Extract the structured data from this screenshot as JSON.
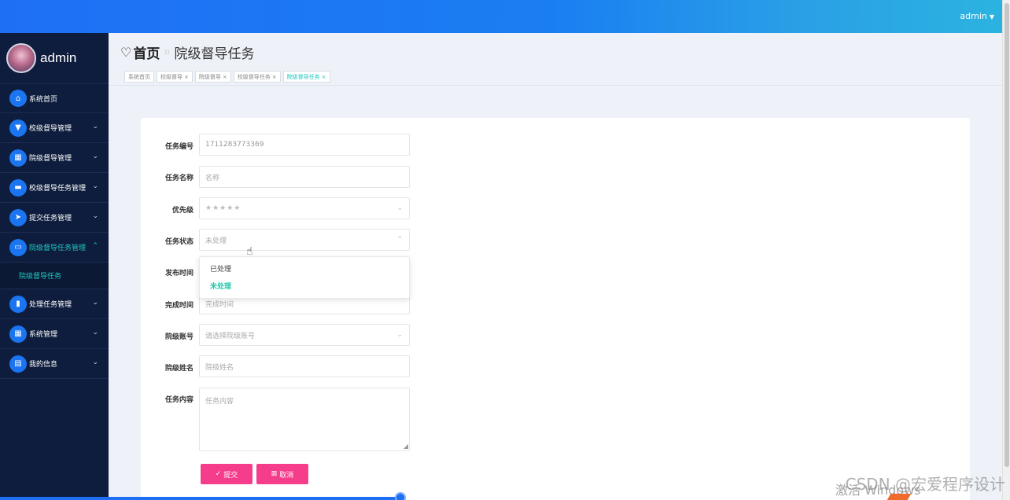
{
  "header": {
    "user": "admin"
  },
  "brand": {
    "name": "admin"
  },
  "sidebar": {
    "items": [
      {
        "label": "系统首页",
        "icon": "home-icon",
        "expanded": null
      },
      {
        "label": "校级督导管理",
        "icon": "presentation-icon",
        "expanded": false
      },
      {
        "label": "院级督导管理",
        "icon": "grid-icon",
        "expanded": false
      },
      {
        "label": "校级督导任务管理",
        "icon": "clipboard-icon",
        "expanded": false
      },
      {
        "label": "提交任务管理",
        "icon": "send-icon",
        "expanded": false
      },
      {
        "label": "院级督导任务管理",
        "icon": "monitor-icon",
        "expanded": true
      },
      {
        "label": "处理任务管理",
        "icon": "bar-chart-icon",
        "expanded": false
      },
      {
        "label": "系统管理",
        "icon": "grid-icon",
        "expanded": false
      },
      {
        "label": "我的信息",
        "icon": "card-icon",
        "expanded": false
      }
    ],
    "submenu": {
      "label": "院级督导任务"
    }
  },
  "breadcrumb": {
    "home": "首页",
    "current": "院级督导任务"
  },
  "tabs": [
    {
      "label": "系统首页",
      "closable": false
    },
    {
      "label": "校级督导",
      "closable": true
    },
    {
      "label": "院级督导",
      "closable": true
    },
    {
      "label": "校级督导任务",
      "closable": true
    },
    {
      "label": "院级督导任务",
      "closable": true,
      "active": true
    }
  ],
  "form": {
    "task_no": {
      "label": "任务编号",
      "value": "1711283773369"
    },
    "task_name": {
      "label": "任务名称",
      "placeholder": "名称"
    },
    "priority": {
      "label": "优先级",
      "value": "★★★★★"
    },
    "status": {
      "label": "任务状态",
      "value": "未处理"
    },
    "publish_time": {
      "label": "发布时间"
    },
    "finish_time": {
      "label": "完成时间",
      "placeholder": "完成时间"
    },
    "college_account": {
      "label": "院级账号",
      "placeholder": "请选择院级账号"
    },
    "college_name": {
      "label": "院级姓名",
      "placeholder": "院级姓名"
    },
    "content": {
      "label": "任务内容",
      "placeholder": "任务内容"
    }
  },
  "status_dropdown": {
    "options": [
      "已处理",
      "未处理"
    ],
    "selected": "未处理"
  },
  "buttons": {
    "submit": "提交",
    "cancel": "取消"
  },
  "overlay": {
    "watermark": "CSDN @宏爱程序设计",
    "activate": "激活 Windows"
  },
  "colors": {
    "accent": "#20c8c0",
    "primary": "#1f6ff5",
    "button": "#f53d8b",
    "sidebar": "#0e1d3d"
  }
}
